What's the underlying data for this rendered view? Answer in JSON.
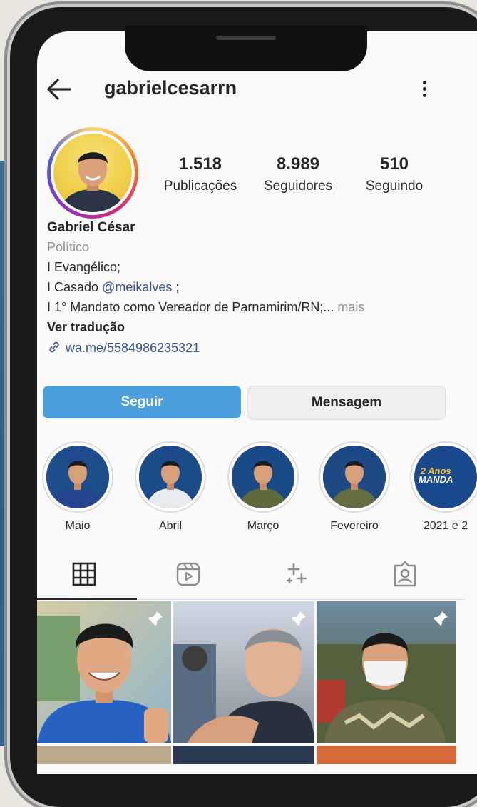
{
  "profile": {
    "username": "gabrielcesarrn",
    "name": "Gabriel César",
    "category": "Político"
  },
  "stats": {
    "posts": {
      "value": "1.518",
      "label": "Publicações"
    },
    "followers": {
      "value": "8.989",
      "label": "Seguidores"
    },
    "following": {
      "value": "510",
      "label": "Seguindo"
    }
  },
  "bio": {
    "line1": "I Evangélico;",
    "line2_prefix": "I Casado ",
    "line2_mention": "@meikalves",
    "line2_suffix": " ;",
    "line3": "I 1° Mandato como Vereador de Parnamirim/RN;...",
    "line3_more": " mais",
    "translate": "Ver tradução",
    "link": "wa.me/5584986235321"
  },
  "actions": {
    "follow": "Seguir",
    "message": "Mensagem"
  },
  "highlights": [
    {
      "label": "Maio"
    },
    {
      "label": "Abril"
    },
    {
      "label": "Março"
    },
    {
      "label": "Fevereiro"
    },
    {
      "label": "2021 e 2",
      "badge_line1": "2 Anos",
      "badge_line2": "MANDA"
    }
  ],
  "tabs": [
    {
      "icon": "grid-icon"
    },
    {
      "icon": "reels-icon"
    },
    {
      "icon": "sparkles-icon"
    },
    {
      "icon": "tagged-icon"
    }
  ],
  "colors": {
    "follow_button": "#4a9fdc",
    "link": "#385185",
    "text": "#262626",
    "muted": "#8e8e8e"
  }
}
